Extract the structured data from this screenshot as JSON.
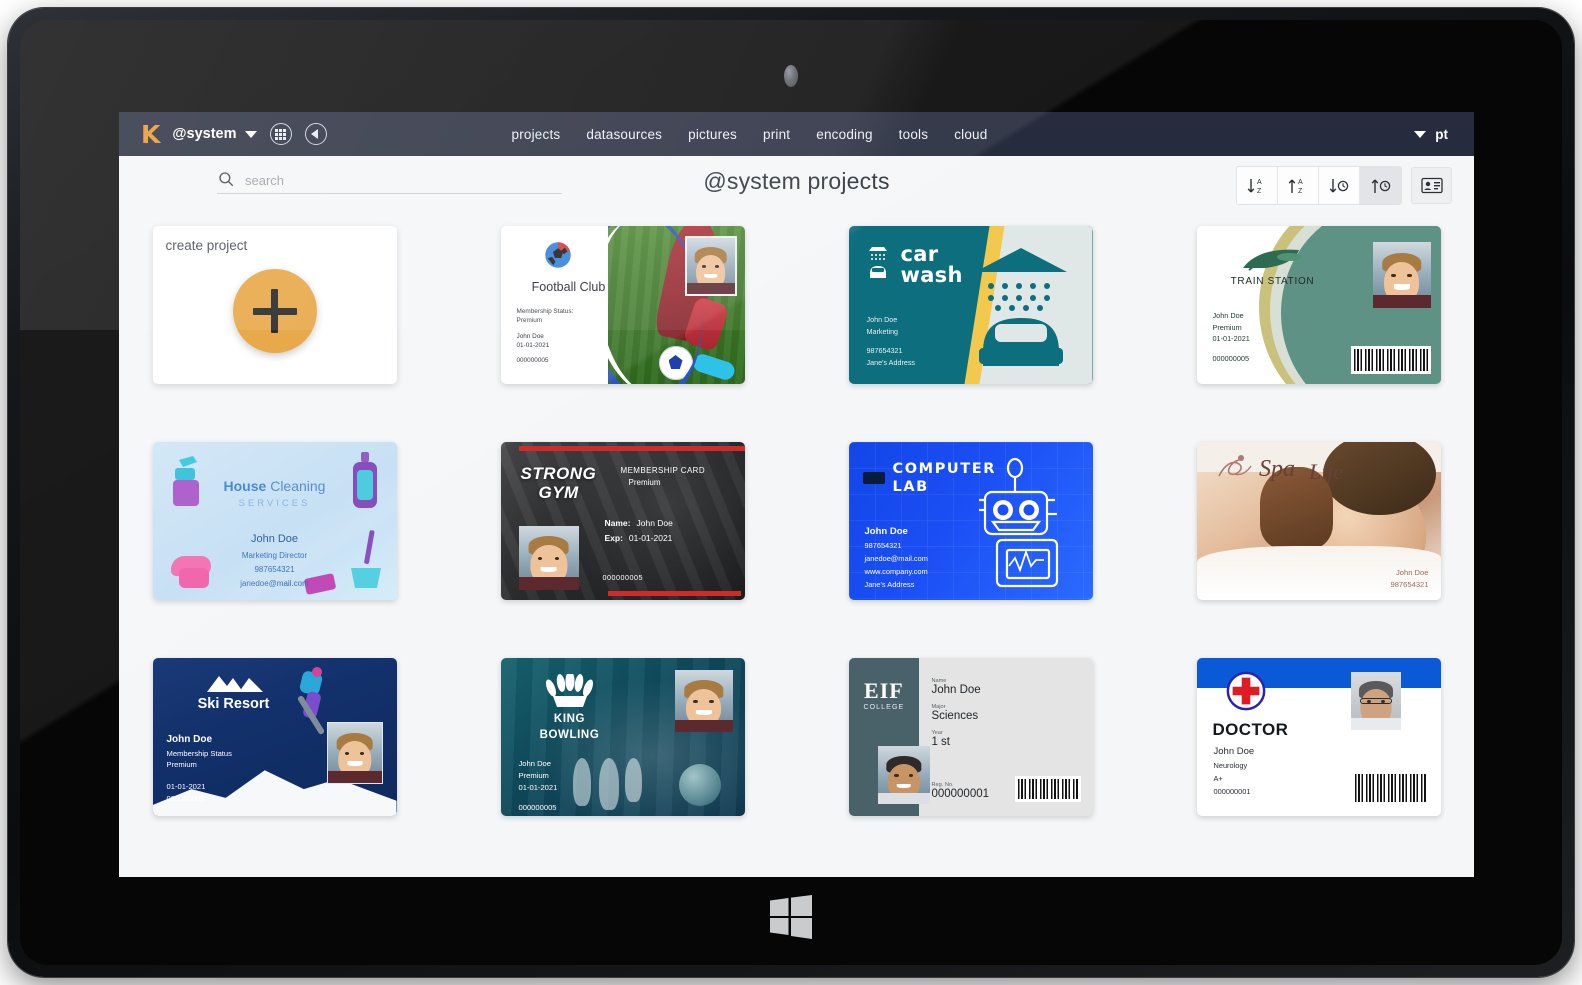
{
  "app": {
    "logo": "k-logo",
    "workspace": "@system",
    "nav_items": [
      "projects",
      "datasources",
      "pictures",
      "print",
      "encoding",
      "tools",
      "cloud"
    ],
    "language": "pt"
  },
  "toolbar": {
    "search_placeholder": "search",
    "search_value": "",
    "page_title": "@system projects",
    "sort_buttons": [
      {
        "name": "sort-name-asc",
        "glyph": "↓",
        "label": "A\nZ",
        "active": false
      },
      {
        "name": "sort-name-desc",
        "glyph": "↑",
        "label": "A\nZ",
        "active": false
      },
      {
        "name": "sort-date-asc",
        "glyph": "↓",
        "label": "clock",
        "active": false
      },
      {
        "name": "sort-date-desc",
        "glyph": "↑",
        "label": "clock",
        "active": true
      }
    ],
    "view_button": "card-view"
  },
  "create_card": {
    "label": "create project",
    "button": "plus"
  },
  "cards": [
    {
      "id": "football-club",
      "title": "Football Club",
      "lines": [
        "Membership Status:",
        "Premium"
      ],
      "person": "John Doe",
      "date": "01-01-2021",
      "number": "000000005"
    },
    {
      "id": "car-wash",
      "title_line1": "car",
      "title_line2": "wash",
      "person": "John Doe",
      "role": "Marketing",
      "phone": "987654321",
      "address": "Jane's Address"
    },
    {
      "id": "train-station",
      "title": "TRAIN STATION",
      "person": "John Doe",
      "status": "Premium",
      "date": "01-01-2021",
      "number": "000000005"
    },
    {
      "id": "house-cleaning",
      "title_bold": "House",
      "title_light": "Cleaning",
      "subtitle": "SERVICES",
      "person": "John Doe",
      "role": "Marketing Director",
      "phone": "987654321",
      "email": "janedoe@mail.com"
    },
    {
      "id": "strong-gym",
      "title_line1": "STRONG",
      "title_line2": "GYM",
      "card_type": "MEMBERSHIP CARD",
      "status": "Premium",
      "name_label": "Name:",
      "person": "John Doe",
      "exp_label": "Exp:",
      "date": "01-01-2021",
      "number": "000000005"
    },
    {
      "id": "computer-lab",
      "title_line1": "COMPUTER",
      "title_line2": "LAB",
      "person": "John Doe",
      "phone": "987654321",
      "email": "janedoe@mail.com",
      "website": "www.company.com",
      "address": "Jane's Address"
    },
    {
      "id": "spa-life",
      "title": "Spa Life",
      "person": "John Doe",
      "phone": "987654321"
    },
    {
      "id": "ski-resort",
      "title": "Ski Resort",
      "person": "John Doe",
      "lines": [
        "Membership Status",
        "Premium"
      ],
      "date": "01-01-2021",
      "number": "000000005"
    },
    {
      "id": "king-bowling",
      "title_line1": "KING",
      "title_line2": "BOWLING",
      "person": "John Doe",
      "status": "Premium",
      "date": "01-01-2021",
      "number": "000000005"
    },
    {
      "id": "eif-college",
      "brand": "EIF",
      "brand_sub": "COLLEGE",
      "fields": [
        {
          "label": "Name",
          "value": "John Doe"
        },
        {
          "label": "Major",
          "value": "Sciences"
        },
        {
          "label": "Year",
          "value": "1 st"
        }
      ],
      "reg_label": "Reg. No.",
      "reg_value": "000000001"
    },
    {
      "id": "doctor",
      "title": "DOCTOR",
      "person": "John Doe",
      "specialty": "Neurology",
      "blood": "A+",
      "number": "000000001"
    }
  ],
  "device": {
    "os_logo": "windows-logo"
  }
}
